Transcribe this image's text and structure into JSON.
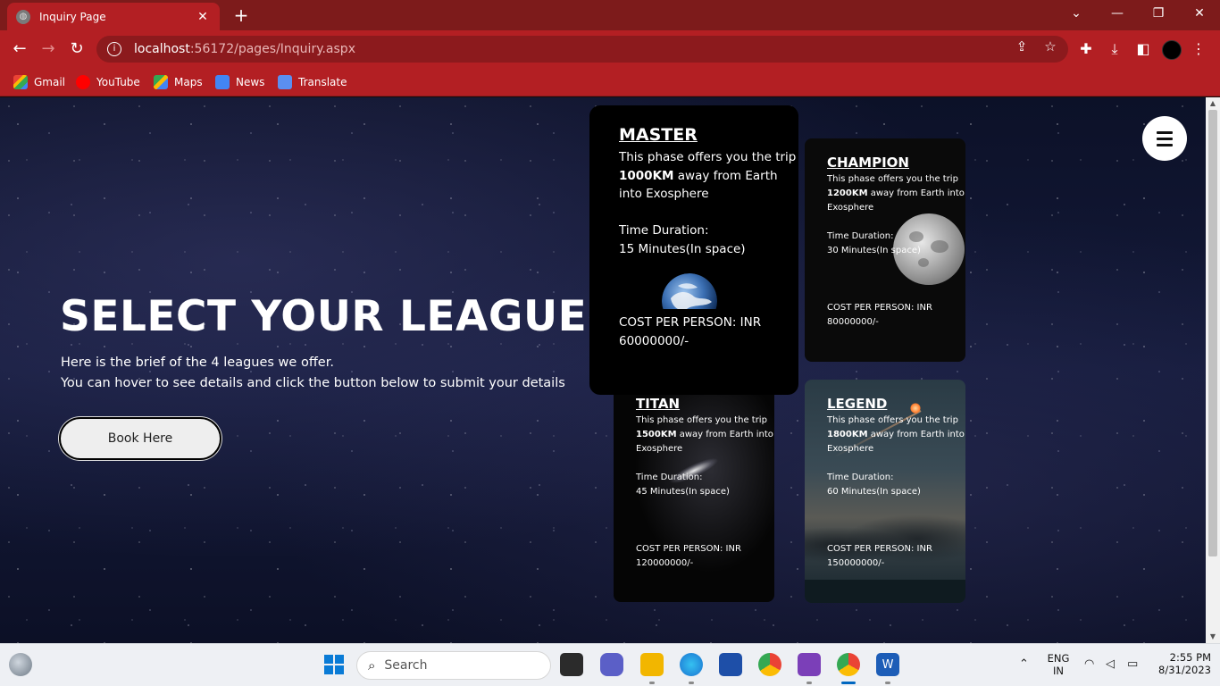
{
  "browser": {
    "tab_title": "Inquiry Page",
    "url_host": "localhost",
    "url_path": ":56172/pages/Inquiry.aspx",
    "bookmarks": [
      "Gmail",
      "YouTube",
      "Maps",
      "News",
      "Translate"
    ]
  },
  "hero": {
    "title": "SELECT YOUR LEAGUE➜",
    "desc_line1": "Here is the brief of the 4 leagues we offer.",
    "desc_line2": "You can hover to see details and click the button below to submit your details",
    "book_button": "Book Here"
  },
  "leagues": {
    "master": {
      "name": "MASTER",
      "text_pre": "This phase offers you the trip ",
      "distance": "1000KM",
      "text_post": " away from Earth into Exosphere",
      "duration_label": "Time Duration:",
      "duration": "15 Minutes(In space)",
      "cost_label": "COST PER PERSON: INR",
      "cost": "60000000/-"
    },
    "champion": {
      "name": "CHAMPION",
      "text_pre": "This phase offers you the trip ",
      "distance": "1200KM",
      "text_post": " away from Earth into Exosphere",
      "duration_label": "Time Duration:",
      "duration": "30 Minutes(In space)",
      "cost_label": "COST PER PERSON: INR",
      "cost": "80000000/-"
    },
    "titan": {
      "name": "TITAN",
      "text_pre": "This phase offers you the trip ",
      "distance": "1500KM",
      "text_post": " away from Earth into Exosphere",
      "duration_label": "Time Duration:",
      "duration": "45 Minutes(In space)",
      "cost_label": "COST PER PERSON: INR",
      "cost": "120000000/-"
    },
    "legend": {
      "name": "LEGEND",
      "text_pre": "This phase offers you the trip ",
      "distance": "1800KM",
      "text_post": " away from Earth into Exosphere",
      "duration_label": "Time Duration:",
      "duration": "60 Minutes(In space)",
      "cost_label": "COST PER PERSON: INR",
      "cost": "150000000/-"
    }
  },
  "taskbar": {
    "search_placeholder": "Search",
    "lang_top": "ENG",
    "lang_bottom": "IN",
    "time": "2:55 PM",
    "date": "8/31/2023"
  },
  "colors": {
    "chrome_tabbar": "#7d1b1b",
    "chrome_toolbar": "#b31f23",
    "page_bg": "#0c1128",
    "card_bg": "#000000"
  }
}
